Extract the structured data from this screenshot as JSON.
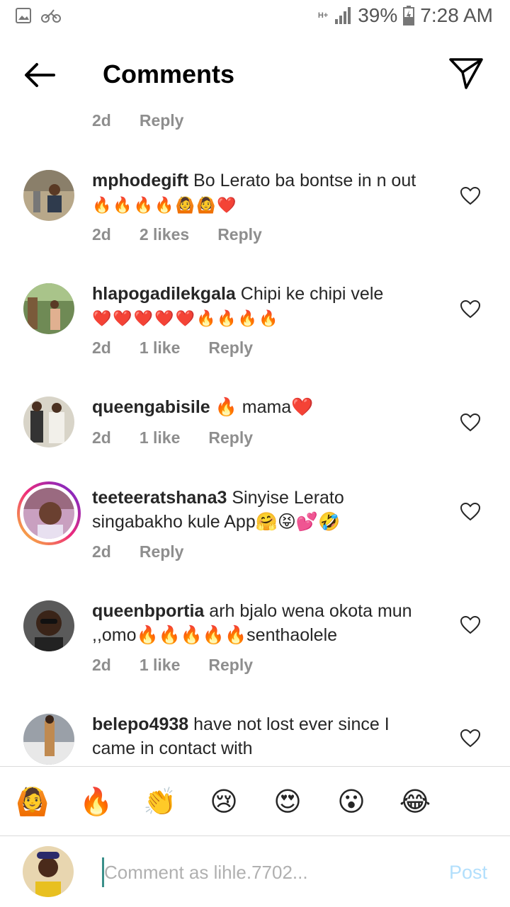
{
  "status_bar": {
    "network": "H+",
    "battery": "39%",
    "time": "7:28 AM"
  },
  "header": {
    "title": "Comments"
  },
  "top_meta": {
    "time": "2d",
    "reply": "Reply"
  },
  "comments": [
    {
      "username": "mphodegift",
      "text": "Bo Lerato ba bontse in n out",
      "emojis": "🔥🔥🔥🔥🙆🙆❤️",
      "time": "2d",
      "likes": "2 likes",
      "reply": "Reply"
    },
    {
      "username": "hlapogadilekgala",
      "text": "Chipi ke chipi vele",
      "emojis": "❤️❤️❤️❤️❤️🔥🔥🔥🔥",
      "time": "2d",
      "likes": "1 like",
      "reply": "Reply"
    },
    {
      "username": "queengabisile",
      "text": "🔥 mama❤️",
      "time": "2d",
      "likes": "1 like",
      "reply": "Reply"
    },
    {
      "username": "teeteeratshana3",
      "text": "Sinyise Lerato singabakho kule App🤗😝💕🤣",
      "time": "2d",
      "reply": "Reply"
    },
    {
      "username": "queenbportia",
      "text": "arh bjalo wena okota mun ,,omo🔥🔥🔥🔥🔥senthaolele",
      "time": "2d",
      "likes": "1 like",
      "reply": "Reply"
    },
    {
      "username": "belepo4938",
      "text": "have not lost ever since I came in contact with"
    }
  ],
  "emoji_bar": [
    "🙆",
    "🔥",
    "👏",
    "😢",
    "😍",
    "😮",
    "😂"
  ],
  "input": {
    "placeholder": "Comment as lihle.7702...",
    "post_label": "Post"
  },
  "colors": {
    "accent_post": "#b2dffc",
    "meta_gray": "#8e8e8e",
    "heart_outline": "#262626"
  }
}
